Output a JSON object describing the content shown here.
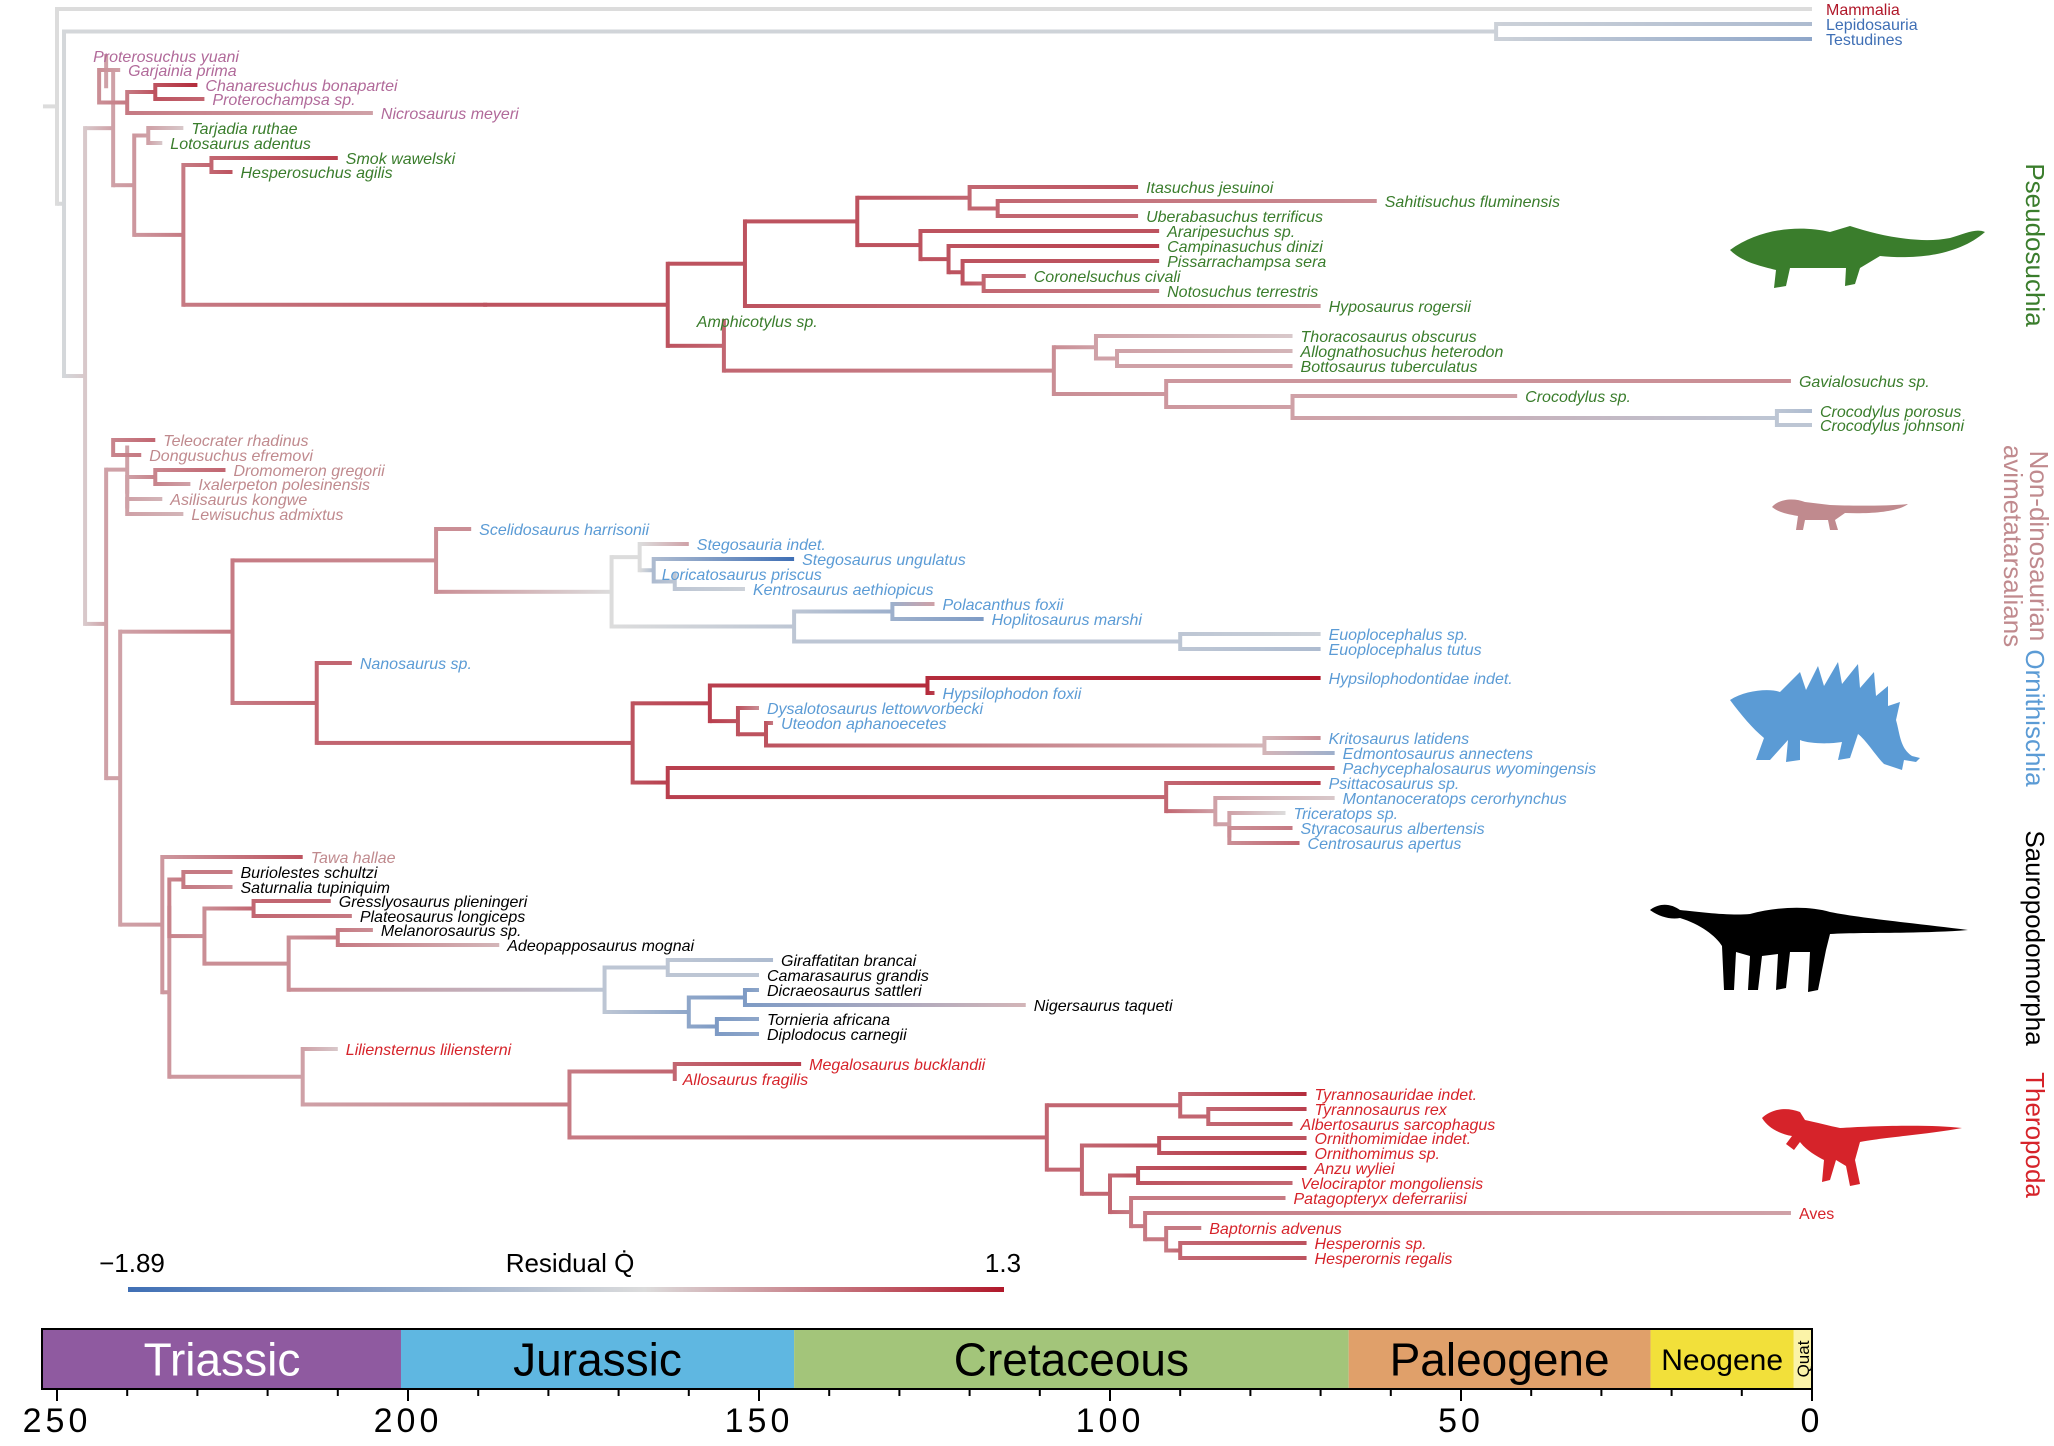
{
  "outgroups": [
    {
      "name": "Mammalia",
      "color": "#b0182a"
    },
    {
      "name": "Lepidosauria",
      "color": "#3f6fb5"
    },
    {
      "name": "Testudines",
      "color": "#3f6fb5"
    }
  ],
  "taxa": {
    "pseudosuchia": [
      "Proterosuchus yuani",
      "Garjainia prima",
      "Chanaresuchus bonapartei",
      "Proterochampsa sp.",
      "Nicrosaurus meyeri",
      "Tarjadia ruthae",
      "Lotosaurus adentus",
      "Smok wawelski",
      "Hesperosuchus agilis",
      "Itasuchus jesuinoi",
      "Sahitisuchus fluminensis",
      "Uberabasuchus terrificus",
      "Araripesuchus sp.",
      "Campinasuchus dinizi",
      "Pissarrachampsa sera",
      "Coronelsuchus civali",
      "Notosuchus terrestris",
      "Hyposaurus rogersii",
      "Amphicotylus sp.",
      "Thoracosaurus obscurus",
      "Allognathosuchus heterodon",
      "Bottosaurus tuberculatus",
      "Gavialosuchus sp.",
      "Crocodylus sp.",
      "Crocodylus porosus",
      "Crocodylus johnsoni"
    ],
    "avemetatarsalians": [
      "Teleocrater rhadinus",
      "Dongusuchus efremovi",
      "Dromomeron gregorii",
      "Ixalerpeton polesinensis",
      "Asilisaurus kongwe",
      "Lewisuchus admixtus"
    ],
    "ornithischia": [
      "Scelidosaurus harrisonii",
      "Stegosauria indet.",
      "Stegosaurus ungulatus",
      "Loricatosaurus priscus",
      "Kentrosaurus aethiopicus",
      "Polacanthus foxii",
      "Hoplitosaurus marshi",
      "Euoplocephalus sp.",
      "Euoplocephalus tutus",
      "Nanosaurus sp.",
      "Hypsilophodontidae indet.",
      "Hypsilophodon foxii",
      "Dysalotosaurus lettowvorbecki",
      "Uteodon aphanoecetes",
      "Kritosaurus latidens",
      "Edmontosaurus annectens",
      "Pachycephalosaurus wyomingensis",
      "Psittacosaurus sp.",
      "Montanoceratops cerorhynchus",
      "Triceratops sp.",
      "Styracosaurus albertensis",
      "Centrosaurus apertus"
    ],
    "tawa": [
      "Tawa hallae"
    ],
    "sauropodomorpha": [
      "Buriolestes schultzi",
      "Saturnalia tupiniquim",
      "Gresslyosaurus plieningeri",
      "Plateosaurus longiceps",
      "Melanorosaurus sp.",
      "Adeopapposaurus mognai",
      "Giraffatitan brancai",
      "Camarasaurus grandis",
      "Dicraeosaurus sattleri",
      "Nigersaurus taqueti",
      "Tornieria africana",
      "Diplodocus carnegii"
    ],
    "theropoda": [
      "Liliensternus liliensterni",
      "Megalosaurus bucklandii",
      "Allosaurus fragilis",
      "Tyrannosauridae indet.",
      "Tyrannosaurus rex",
      "Albertosaurus sarcophagus",
      "Ornithomimidae indet.",
      "Ornithomimus sp.",
      "Anzu wyliei",
      "Velociraptor mongoliensis",
      "Patagopteryx deferrariisi",
      "Aves",
      "Baptornis advenus",
      "Hesperornis sp.",
      "Hesperornis regalis"
    ]
  },
  "clades": [
    {
      "name": "Pseudosuchia",
      "color": "#3a7d2c"
    },
    {
      "name": "Non-dinosaurian avimetatarsalians",
      "color": "#c08a8e"
    },
    {
      "name": "Ornithischia",
      "color": "#5b9bd5"
    },
    {
      "name": "Sauropodomorpha",
      "color": "#000000"
    },
    {
      "name": "Theropoda",
      "color": "#d6232a"
    }
  ],
  "legend": {
    "title": "Residual Q̇",
    "min_label": "−1.89",
    "max_label": "1.3",
    "color_min": "#3f6fb5",
    "color_mid": "#dcdcdc",
    "color_max": "#b0182a"
  },
  "timescale": {
    "periods": [
      {
        "name": "Triassic",
        "start": 252,
        "end": 201,
        "color": "#8f5aa0"
      },
      {
        "name": "Jurassic",
        "start": 201,
        "end": 145,
        "color": "#5fb7e1"
      },
      {
        "name": "Cretaceous",
        "start": 145,
        "end": 66,
        "color": "#a3c57a"
      },
      {
        "name": "Paleogene",
        "start": 66,
        "end": 23,
        "color": "#e0a06a"
      },
      {
        "name": "Neogene",
        "start": 23,
        "end": 2.6,
        "color": "#f2e03a"
      },
      {
        "name": "Quat",
        "start": 2.6,
        "end": 0,
        "color": "#fbf3a8"
      }
    ],
    "ticks": [
      "250",
      "200",
      "150",
      "100",
      "50",
      "0"
    ]
  }
}
